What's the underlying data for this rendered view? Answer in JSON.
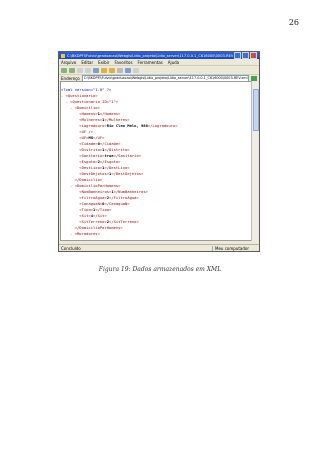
{
  "page": {
    "number": "26"
  },
  "browser": {
    "title": "C:\\BKDPFI\\Fulvio\\graduacao\\Webgis\\Lidio_projeto\\Lidio_server\\117.0.0.1_C616000\\0003-REV.xml - Microsoft Internet Explorer",
    "menu": [
      "Arquivo",
      "Editar",
      "Exibir",
      "Favoritos",
      "Ferramentas",
      "Ajuda"
    ],
    "address_label": "Endereço",
    "address_value": "C:\\BKDPFI\\Fulvio\\graduacao\\Webgis\\Lidio_projeto\\Lidio_server\\117.0.0.1_C616000\\0003-REV.xml",
    "status_left": "Concluído",
    "status_right": "Meu computador"
  },
  "xml_lines": [
    {
      "minus": "",
      "indent": "",
      "open": "<?xml version=\"1.0\" ?>",
      "text": "",
      "close": ""
    },
    {
      "minus": "- ",
      "indent": "",
      "open": "<Questionario>",
      "text": "",
      "close": ""
    },
    {
      "minus": "- ",
      "indent": "  ",
      "open": "<Questionario ID=\"1\">",
      "text": "",
      "close": ""
    },
    {
      "minus": "- ",
      "indent": "    ",
      "open": "<Domicilio>",
      "text": "",
      "close": ""
    },
    {
      "minus": "",
      "indent": "        ",
      "open": "<Homens>",
      "text": "1",
      "close": "</Homens>"
    },
    {
      "minus": "",
      "indent": "        ",
      "open": "<Mulheres>",
      "text": "1",
      "close": "</Mulheres>"
    },
    {
      "minus": "",
      "indent": "        ",
      "open": "<Logradouro>",
      "text": "Rio Cleo Melo, 980",
      "close": "</Logradouro>"
    },
    {
      "minus": "",
      "indent": "        ",
      "open": "<UF />",
      "text": "",
      "close": ""
    },
    {
      "minus": "",
      "indent": "        ",
      "open": "<UF>",
      "text": "MG",
      "close": "</UF>"
    },
    {
      "minus": "",
      "indent": "        ",
      "open": "<Cidade>",
      "text": "0",
      "close": "</Cidade>"
    },
    {
      "minus": "",
      "indent": "        ",
      "open": "<Distrito>",
      "text": "1",
      "close": "</Distrito>"
    },
    {
      "minus": "",
      "indent": "        ",
      "open": "<Sanitario>",
      "text": "true",
      "close": "</Sanitario>"
    },
    {
      "minus": "",
      "indent": "        ",
      "open": "<Esgoto>",
      "text": "2",
      "close": "</Esgoto>"
    },
    {
      "minus": "",
      "indent": "        ",
      "open": "<DestLixo>",
      "text": "1",
      "close": "</DestLixo>"
    },
    {
      "minus": "",
      "indent": "        ",
      "open": "<DestDejetos>",
      "text": "1",
      "close": "</DestDejetos>"
    },
    {
      "minus": "",
      "indent": "      ",
      "open": "</Domicilio>",
      "text": "",
      "close": ""
    },
    {
      "minus": "- ",
      "indent": "    ",
      "open": "<DomicilioParHomens>",
      "text": "",
      "close": ""
    },
    {
      "minus": "",
      "indent": "        ",
      "open": "<NumBanheiros>",
      "text": "1",
      "close": "</NumBanheiros>"
    },
    {
      "minus": "",
      "indent": "        ",
      "open": "<FiltroAgua>",
      "text": "2",
      "close": "</FiltroAgua>"
    },
    {
      "minus": "",
      "indent": "        ",
      "open": "<CanaguaN>",
      "text": "0",
      "close": "</CanaguaN>"
    },
    {
      "minus": "",
      "indent": "        ",
      "open": "<Tipo>",
      "text": "1",
      "close": "</Tipo>"
    },
    {
      "minus": "",
      "indent": "        ",
      "open": "<Sit>",
      "text": "4",
      "close": "</Sit>"
    },
    {
      "minus": "",
      "indent": "        ",
      "open": "<SitTerreno>",
      "text": "2",
      "close": "</SitTerreno>"
    },
    {
      "minus": "",
      "indent": "      ",
      "open": "</DomicilioParHomens>",
      "text": "",
      "close": ""
    },
    {
      "minus": "- ",
      "indent": "    ",
      "open": "<Moradores>",
      "text": "",
      "close": ""
    }
  ],
  "caption": "Figura 19: Dados armazenados em XML"
}
